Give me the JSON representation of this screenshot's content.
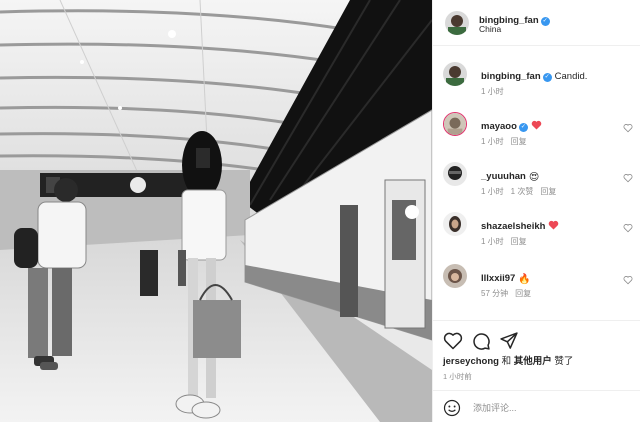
{
  "post": {
    "author": "bingbing_fan",
    "location": "China",
    "caption": "Candid.",
    "caption_time": "1 小时"
  },
  "comments": [
    {
      "user": "mayaoo",
      "verified": true,
      "text_icon": "red-heart-emoji",
      "time": "1 小时",
      "reply": "回复",
      "likes": ""
    },
    {
      "user": "_yuuuhan",
      "verified": false,
      "text_icon": "heart-eyes-emoji",
      "time": "1 小时",
      "likes": "1 次赞",
      "reply": "回复"
    },
    {
      "user": "shazaelsheikh",
      "verified": false,
      "text_icon": "red-heart-emoji",
      "time": "1 小时",
      "reply": "回复",
      "likes": ""
    },
    {
      "user": "lllxxii97",
      "verified": false,
      "text_icon": "fire-emoji",
      "time": "57 分钟",
      "reply": "回复",
      "likes": ""
    }
  ],
  "likes_line": {
    "first_user": "jerseychong",
    "connector": " 和 ",
    "others": "其他用户",
    "suffix": " 赞了"
  },
  "post_time": "1 小时前",
  "add_comment_placeholder": "添加评论...",
  "icons": {
    "like": "heart-outline-icon",
    "comment": "speech-bubble-icon",
    "share": "paper-plane-icon",
    "emoji": "smiley-icon"
  },
  "colors": {
    "verified": "#3897f0",
    "heart": "#ed4956",
    "muted": "#8e8e8e"
  }
}
